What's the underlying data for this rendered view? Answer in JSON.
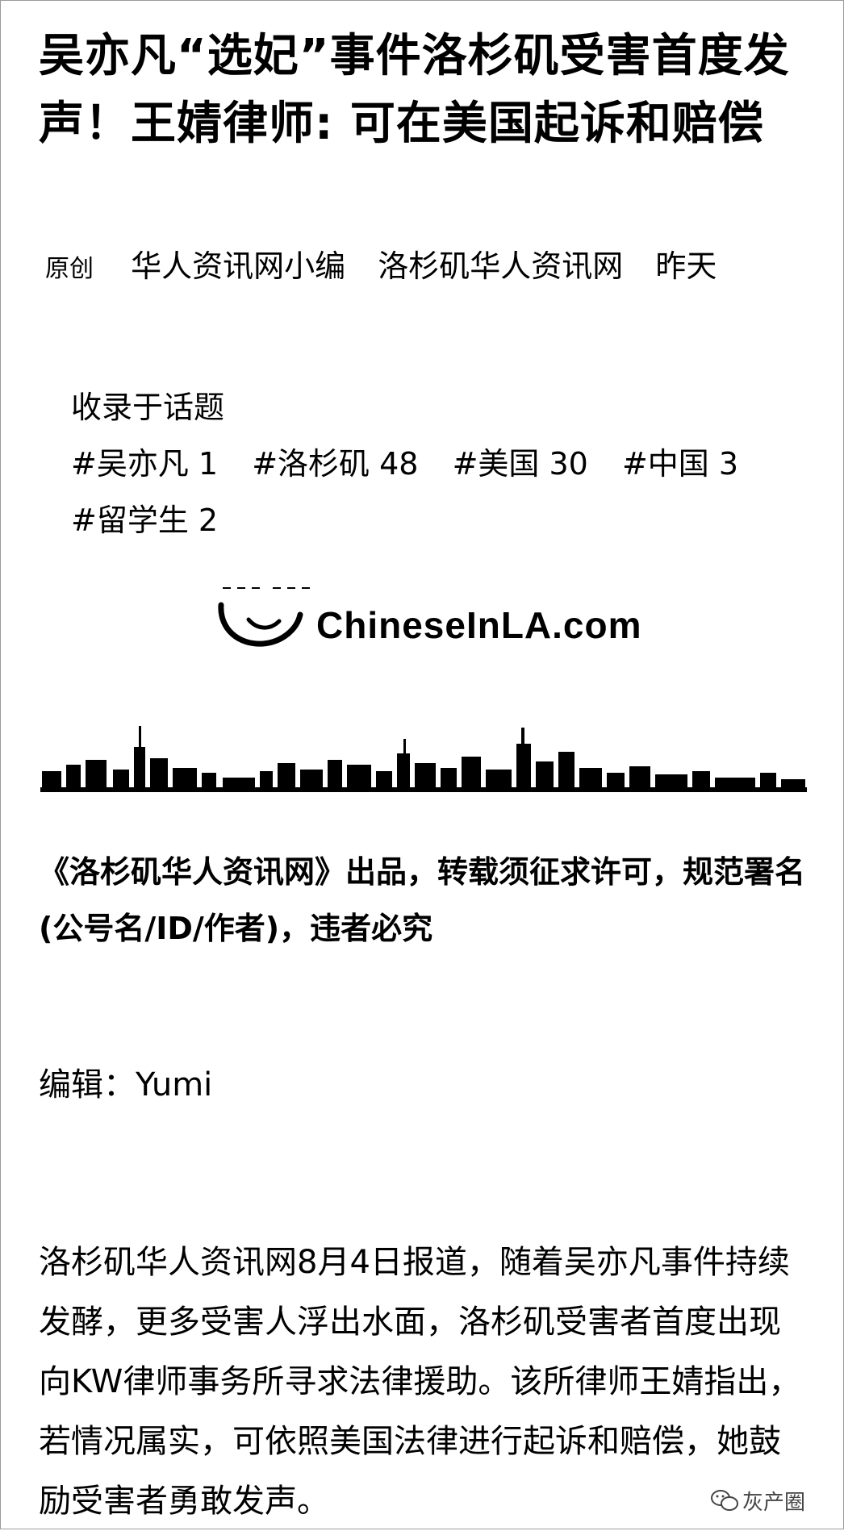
{
  "article": {
    "title": "吴亦凡“选妃”事件洛杉矶受害首度发声！王婧律师: 可在美国起诉和赔偿",
    "meta": {
      "original_tag": "原创",
      "author": "华人资讯网小编",
      "account": "洛杉矶华人资讯网",
      "date": "昨天"
    },
    "topics": {
      "header": "收录于话题",
      "items": [
        "#吴亦凡 1",
        "#洛杉矶 48",
        "#美国 30",
        "#中国 3",
        "#留学生 2"
      ]
    },
    "logo": {
      "text": "ChineseInLA.com",
      "icon": "cloud-swoosh-logo"
    },
    "banner": {
      "icon": "city-skyline"
    },
    "notice": "《洛杉矶华人资讯网》出品，转载须征求许可，规范署名(公号名/ID/作者)，违者必究",
    "editor": "编辑：Yumi",
    "body": "洛杉矶华人资讯网8月4日报道，随着吴亦凡事件持续发酵，更多受害人浮出水面，洛杉矶受害者首度出现向KW律师事务所寻求法律援助。该所律师王婧指出，若情况属实，可依照美国法律进行起诉和赔偿，她鼓励受害者勇敢发声。"
  },
  "watermark": {
    "icon": "wechat-icon",
    "text": "灰产圈"
  }
}
